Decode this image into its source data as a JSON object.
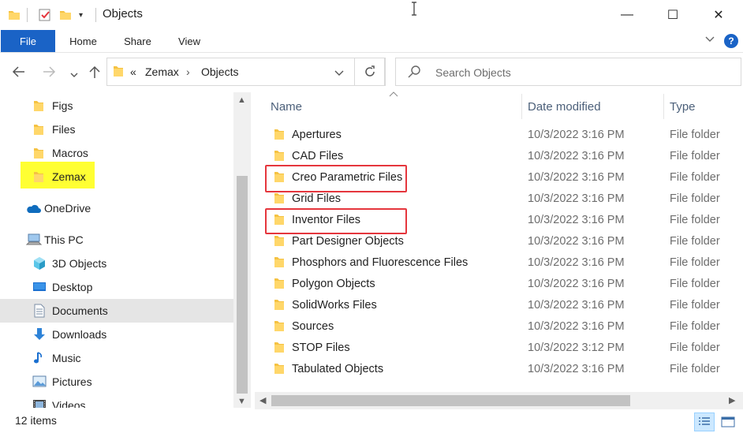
{
  "window": {
    "title": "Objects",
    "minimize_glyph": "—",
    "maximize_glyph": "☐",
    "close_glyph": "✕"
  },
  "ribbon": {
    "tabs": [
      "File",
      "Home",
      "Share",
      "View"
    ],
    "help_glyph": "?"
  },
  "address": {
    "overflow": "«",
    "segments": [
      "Zemax",
      "Objects"
    ],
    "separator": "›"
  },
  "search": {
    "placeholder": "Search Objects"
  },
  "nav_pane": {
    "items": [
      {
        "label": "Figs",
        "icon": "folder-icon"
      },
      {
        "label": "Files",
        "icon": "folder-icon"
      },
      {
        "label": "Macros",
        "icon": "folder-icon"
      },
      {
        "label": "Zemax",
        "icon": "folder-icon",
        "highlighted": true
      },
      {
        "label": "OneDrive",
        "icon": "onedrive-icon"
      },
      {
        "label": "This PC",
        "icon": "pc-icon"
      },
      {
        "label": "3D Objects",
        "icon": "3d-objects-icon"
      },
      {
        "label": "Desktop",
        "icon": "desktop-icon"
      },
      {
        "label": "Documents",
        "icon": "documents-icon",
        "selected": true
      },
      {
        "label": "Downloads",
        "icon": "downloads-icon"
      },
      {
        "label": "Music",
        "icon": "music-icon"
      },
      {
        "label": "Pictures",
        "icon": "pictures-icon"
      },
      {
        "label": "Videos",
        "icon": "videos-icon"
      }
    ]
  },
  "columns": {
    "name": "Name",
    "date": "Date modified",
    "type": "Type"
  },
  "files": [
    {
      "name": "Apertures",
      "date": "10/3/2022 3:16 PM",
      "type": "File folder"
    },
    {
      "name": "CAD Files",
      "date": "10/3/2022 3:16 PM",
      "type": "File folder"
    },
    {
      "name": "Creo Parametric Files",
      "date": "10/3/2022 3:16 PM",
      "type": "File folder",
      "boxed": true
    },
    {
      "name": "Grid Files",
      "date": "10/3/2022 3:16 PM",
      "type": "File folder"
    },
    {
      "name": "Inventor Files",
      "date": "10/3/2022 3:16 PM",
      "type": "File folder",
      "boxed": true
    },
    {
      "name": "Part Designer Objects",
      "date": "10/3/2022 3:16 PM",
      "type": "File folder"
    },
    {
      "name": "Phosphors and Fluorescence Files",
      "date": "10/3/2022 3:16 PM",
      "type": "File folder"
    },
    {
      "name": "Polygon Objects",
      "date": "10/3/2022 3:16 PM",
      "type": "File folder"
    },
    {
      "name": "SolidWorks Files",
      "date": "10/3/2022 3:16 PM",
      "type": "File folder"
    },
    {
      "name": "Sources",
      "date": "10/3/2022 3:16 PM",
      "type": "File folder"
    },
    {
      "name": "STOP Files",
      "date": "10/3/2022 3:12 PM",
      "type": "File folder"
    },
    {
      "name": "Tabulated Objects",
      "date": "10/3/2022 3:16 PM",
      "type": "File folder"
    }
  ],
  "status": {
    "count": "12 items"
  },
  "colors": {
    "accent": "#1a63c6",
    "folder": "#f5c242",
    "highlight": "#ffff33",
    "annotation": "#e5363d"
  }
}
